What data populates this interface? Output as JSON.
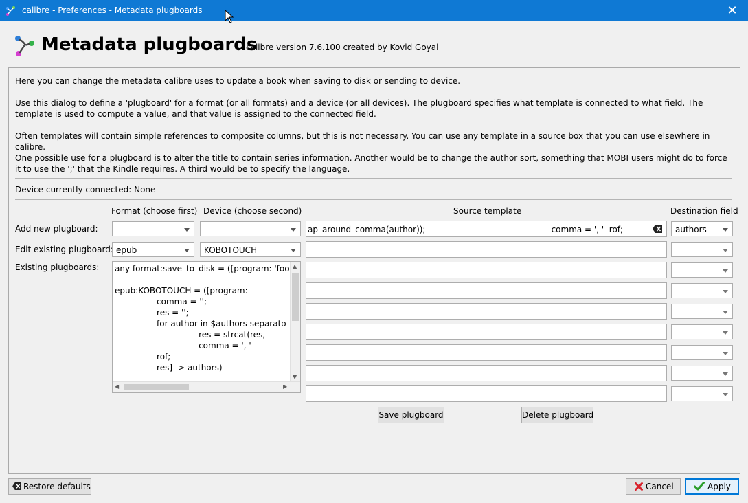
{
  "window": {
    "title": "calibre - Preferences - Metadata plugboards",
    "close_glyph": "✕"
  },
  "header": {
    "title": "Metadata plugboards",
    "version": "calibre version 7.6.100 created by Kovid Goyal"
  },
  "intro": {
    "p1": "Here you can change the metadata calibre uses to update a book when saving to disk or sending to device.",
    "p2": "Use this dialog to define a 'plugboard' for a format (or all formats) and a device (or all devices). The plugboard specifies what template is connected to what field. The template is used to compute a value, and that value is assigned to the connected field.",
    "p3": "Often templates will contain simple references to composite columns, but this is not necessary. You can use any template in a source box that you can use elsewhere in calibre.",
    "p4": "One possible use for a plugboard is to alter the title to contain series information. Another would be to change the author sort, something that MOBI users might do to force it to use the ';' that the Kindle requires. A third would be to specify the language."
  },
  "device_status": "Device currently connected: None",
  "columns": {
    "format": "Format (choose first)",
    "device": "Device (choose second)",
    "source": "Source template",
    "destination": "Destination field"
  },
  "rows": {
    "add_label": "Add new plugboard:",
    "edit_label": "Edit existing plugboard:",
    "existing_label": "Existing plugboards:",
    "add_format": "",
    "add_device": "",
    "edit_format": "epub",
    "edit_device": "KOBOTOUCH"
  },
  "source_templates": [
    {
      "value": "ap_around_comma(author));                                                comma = ', '  rof;                    res",
      "destination": "authors"
    },
    {
      "value": "",
      "destination": ""
    },
    {
      "value": "",
      "destination": ""
    },
    {
      "value": "",
      "destination": ""
    },
    {
      "value": "",
      "destination": ""
    },
    {
      "value": "",
      "destination": ""
    },
    {
      "value": "",
      "destination": ""
    },
    {
      "value": "",
      "destination": ""
    },
    {
      "value": "",
      "destination": ""
    }
  ],
  "existing_plugboards": [
    "any format:save_to_disk = ([program: 'foo' &",
    "",
    "epub:KOBOTOUCH = ([program:",
    "                comma = '';",
    "                res = '';",
    "                for author in $authors separato",
    "                                res = strcat(res,",
    "                                comma = ', '",
    "                rof;",
    "                res] -> authors)"
  ],
  "buttons": {
    "save": "Save plugboard",
    "delete": "Delete plugboard",
    "restore": "Restore defaults",
    "cancel": "Cancel",
    "apply": "Apply"
  },
  "colors": {
    "titlebar": "#0f79d4",
    "cancel_icon": "#d9232d",
    "apply_icon": "#2c9e2c"
  }
}
